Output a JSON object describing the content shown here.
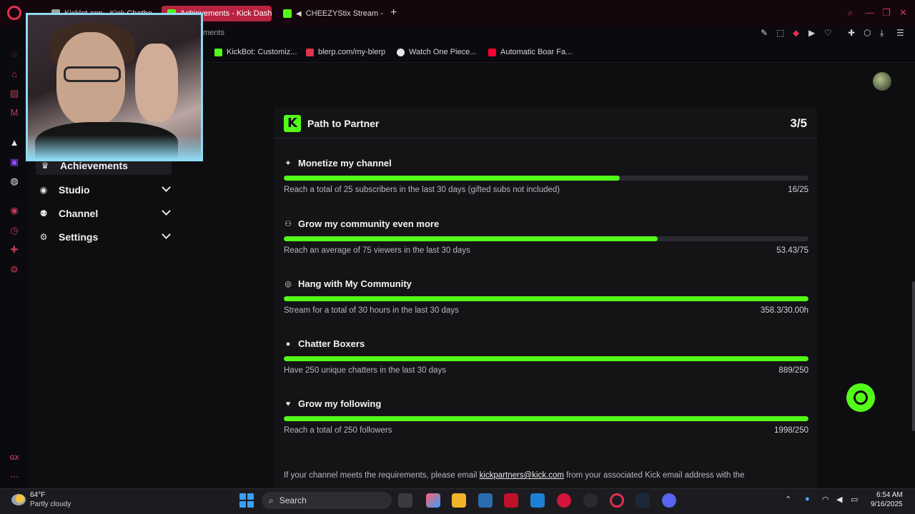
{
  "browser": {
    "tabs": [
      {
        "label": "Kicklet.app - Kick Chatbo",
        "color": "#9aa39a",
        "active": false
      },
      {
        "label": "Achievements - Kick Dash",
        "color": "#53fc18",
        "active": true
      },
      {
        "label": "CHEEZYStix Stream -",
        "color": "#53fc18",
        "active": false
      }
    ],
    "new_tab_icon": "plus-icon",
    "address_fragment": "ments",
    "bookmarks": [
      {
        "label": "KickBot: Customiz...",
        "color": "#53fc18"
      },
      {
        "label": "blerp.com/my-blerp",
        "color": "#e0314f"
      },
      {
        "label": "Watch One Piece...",
        "color": "#e6e6e9"
      },
      {
        "label": "Automatic Boar Fa...",
        "color": "#ff0033"
      }
    ]
  },
  "sidebar": {
    "items": [
      {
        "label": "Achievements",
        "icon": "trophy-icon",
        "glyph": "♛",
        "active": true,
        "expandable": false
      },
      {
        "label": "Studio",
        "icon": "camera-icon",
        "glyph": "◉",
        "active": false,
        "expandable": true
      },
      {
        "label": "Channel",
        "icon": "people-icon",
        "glyph": "⚉",
        "active": false,
        "expandable": true
      },
      {
        "label": "Settings",
        "icon": "gear-icon",
        "glyph": "⚙",
        "active": false,
        "expandable": true
      }
    ]
  },
  "card": {
    "title": "Path to Partner",
    "count": "3/5",
    "achievements": [
      {
        "title": "Monetize my channel",
        "icon": "sparkle-icon",
        "glyph": "✦",
        "description": "Reach a total of 25 subscribers in the last 30 days (gifted subs not included)",
        "value": "16/25",
        "progress": 0.64
      },
      {
        "title": "Grow my community even more",
        "icon": "community-icon",
        "glyph": "⚇",
        "description": "Reach an average of 75 viewers in the last 30 days",
        "value": "53.43/75",
        "progress": 0.7124
      },
      {
        "title": "Hang with My Community",
        "icon": "broadcast-icon",
        "glyph": "◎",
        "description": "Stream for a total of 30 hours in the last 30 days",
        "value": "358.3/30.00h",
        "progress": 1.0
      },
      {
        "title": "Chatter Boxers",
        "icon": "chat-icon",
        "glyph": "●",
        "description": "Have 250 unique chatters in the last 30 days",
        "value": "889/250",
        "progress": 1.0
      },
      {
        "title": "Grow my following",
        "icon": "heart-icon",
        "glyph": "♥",
        "description": "Reach a total of 250 followers",
        "value": "1998/250",
        "progress": 1.0
      }
    ],
    "note_before": "If your channel meets the requirements, please email ",
    "note_email": "kickpartners@kick.com",
    "note_after": " from your associated Kick email address with the"
  },
  "taskbar": {
    "temperature": "64°F",
    "condition": "Partly cloudy",
    "search_label": "Search",
    "time": "6:54 AM",
    "date": "9/16/2025"
  },
  "colors": {
    "accent": "#53fc18",
    "opera_red": "#e0314f"
  }
}
